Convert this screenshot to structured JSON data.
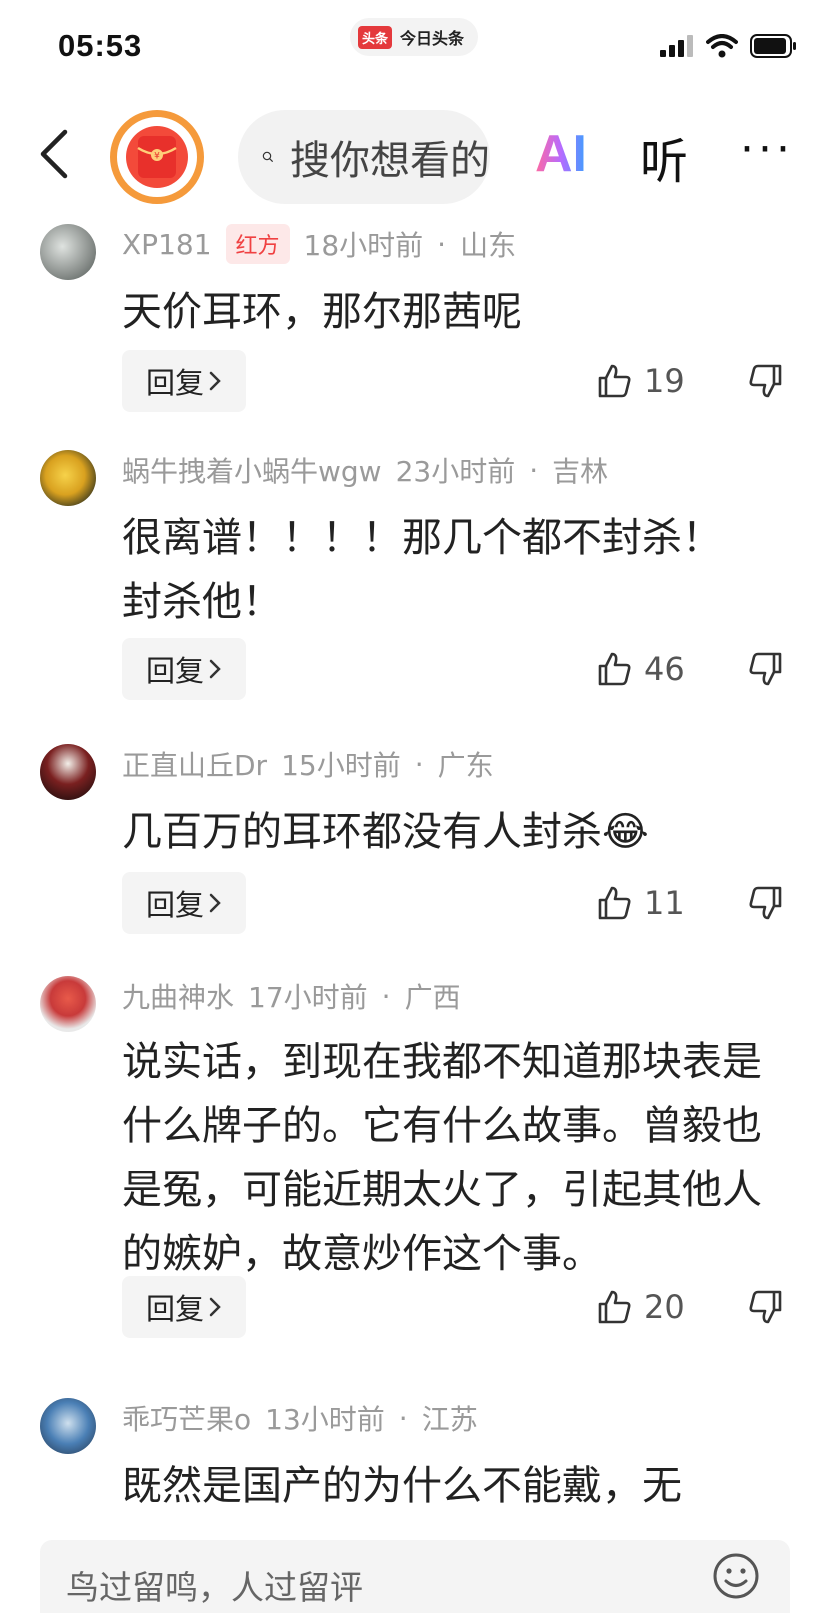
{
  "status_bar": {
    "time": "05:53",
    "app_logo_text": "头条",
    "app_name": "今日头条"
  },
  "nav": {
    "search_placeholder": "搜你想看的",
    "ai_label": "AI",
    "listen_label": "听",
    "more_label": "···",
    "colors": {
      "redpacket_ring": "#f59a3b",
      "redpacket": "#f34a3a"
    }
  },
  "comments": [
    {
      "user": "XP181",
      "badge": "红方",
      "time": "18小时前",
      "location": "山东",
      "text": "天价耳环，那尔那茜呢",
      "reply_label": "回复",
      "likes": "19",
      "avatar_color": "#8a8f8c"
    },
    {
      "user": "蜗牛拽着小蜗牛wgw",
      "badge": "",
      "time": "23小时前",
      "location": "吉林",
      "text": "很离谱！！！！那几个都不封杀！封杀他！",
      "reply_label": "回复",
      "likes": "46",
      "avatar_color": "#d9a11f"
    },
    {
      "user": "正直山丘Dr",
      "badge": "",
      "time": "15小时前",
      "location": "广东",
      "text": "几百万的耳环都没有人封杀😂",
      "reply_label": "回复",
      "likes": "11",
      "avatar_color": "#7a2020"
    },
    {
      "user": "九曲神水",
      "badge": "",
      "time": "17小时前",
      "location": "广西",
      "text": "说实话，到现在我都不知道那块表是什么牌子的。它有什么故事。曾毅也是冤，可能近期太火了，引起其他人的嫉妒，故意炒作这个事。",
      "reply_label": "回复",
      "likes": "20",
      "avatar_color": "#c83a3a"
    },
    {
      "user": "乖巧芒果o",
      "badge": "",
      "time": "13小时前",
      "location": "江苏",
      "text": "既然是国产的为什么不能戴，无",
      "reply_label": "",
      "likes": "",
      "avatar_color": "#4a7fb5"
    }
  ],
  "bottom": {
    "input_placeholder": "鸟过留鸣，人过留评"
  }
}
